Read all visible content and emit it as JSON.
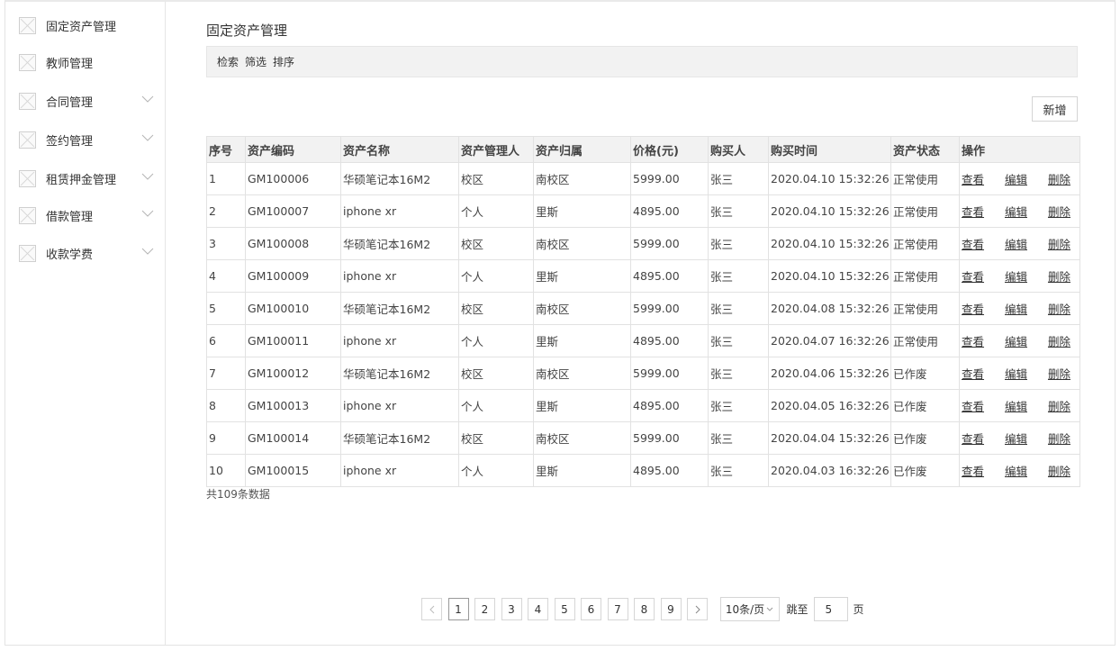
{
  "sidebar": {
    "items": [
      {
        "label": "固定资产管理",
        "expandable": false,
        "icon": "placeholder-image-icon"
      },
      {
        "label": "教师管理",
        "expandable": false,
        "icon": "placeholder-image-icon"
      },
      {
        "label": "合同管理",
        "expandable": true,
        "icon": "placeholder-image-icon"
      },
      {
        "label": "签约管理",
        "expandable": true,
        "icon": "placeholder-image-icon"
      },
      {
        "label": "租赁押金管理",
        "expandable": true,
        "icon": "placeholder-image-icon"
      },
      {
        "label": "借款管理",
        "expandable": true,
        "icon": "placeholder-image-icon"
      },
      {
        "label": "收款学费",
        "expandable": true,
        "icon": "placeholder-image-icon"
      }
    ]
  },
  "main": {
    "title": "固定资产管理",
    "toolbar": {
      "search": "检索",
      "filter": "筛选",
      "sort": "排序"
    },
    "add_button": "新增",
    "table": {
      "headers": [
        "序号",
        "资产编码",
        "资产名称",
        "资产管理人",
        "资产归属",
        "价格(元)",
        "购买人",
        "购买时间",
        "资产状态",
        "操作"
      ],
      "actions": {
        "view": "查看",
        "edit": "编辑",
        "delete": "删除"
      },
      "rows": [
        [
          "1",
          "GM100006",
          "华硕笔记本16M2",
          "校区",
          "南校区",
          "5999.00",
          "张三",
          "2020.04.10 15:32:26",
          "正常使用"
        ],
        [
          "2",
          "GM100007",
          "iphone xr",
          "个人",
          "里斯",
          "4895.00",
          "张三",
          "2020.04.10 15:32:26",
          "正常使用"
        ],
        [
          "3",
          "GM100008",
          "华硕笔记本16M2",
          "校区",
          "南校区",
          "5999.00",
          "张三",
          "2020.04.10 15:32:26",
          "正常使用"
        ],
        [
          "4",
          "GM100009",
          "iphone xr",
          "个人",
          "里斯",
          "4895.00",
          "张三",
          "2020.04.10 15:32:26",
          "正常使用"
        ],
        [
          "5",
          "GM100010",
          "华硕笔记本16M2",
          "校区",
          "南校区",
          "5999.00",
          "张三",
          "2020.04.08 15:32:26",
          "正常使用"
        ],
        [
          "6",
          "GM100011",
          "iphone xr",
          "个人",
          "里斯",
          "4895.00",
          "张三",
          "2020.04.07 16:32:26",
          "正常使用"
        ],
        [
          "7",
          "GM100012",
          "华硕笔记本16M2",
          "校区",
          "南校区",
          "5999.00",
          "张三",
          "2020.04.06 15:32:26",
          "已作废"
        ],
        [
          "8",
          "GM100013",
          "iphone xr",
          "个人",
          "里斯",
          "4895.00",
          "张三",
          "2020.04.05 16:32:26",
          "已作废"
        ],
        [
          "9",
          "GM100014",
          "华硕笔记本16M2",
          "校区",
          "南校区",
          "5999.00",
          "张三",
          "2020.04.04 15:32:26",
          "已作废"
        ],
        [
          "10",
          "GM100015",
          "iphone xr",
          "个人",
          "里斯",
          "4895.00",
          "张三",
          "2020.04.03 16:32:26",
          "已作废"
        ]
      ]
    },
    "total_text": "共109条数据",
    "pagination": {
      "pages": [
        "1",
        "2",
        "3",
        "4",
        "5",
        "6",
        "7",
        "8",
        "9"
      ],
      "current_page": "1",
      "page_size": "10条/页",
      "jump_label": "跳至",
      "jump_value": "5",
      "jump_unit": "页"
    }
  }
}
